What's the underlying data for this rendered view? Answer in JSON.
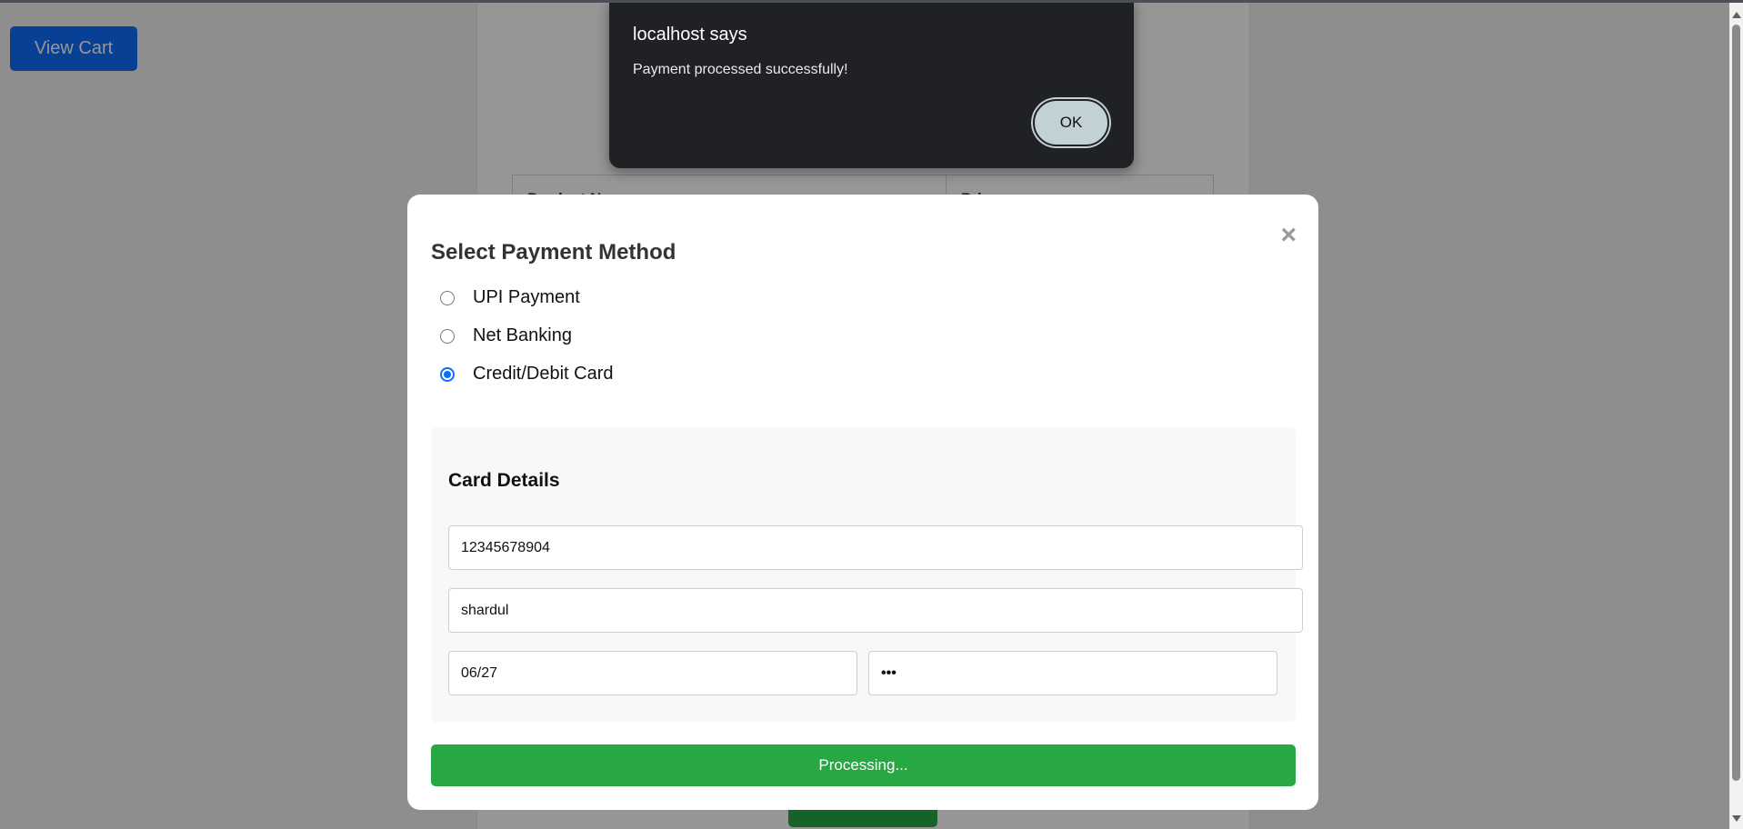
{
  "page": {
    "view_cart_label": "View Cart",
    "table_headers": [
      "Product Name",
      "Price"
    ]
  },
  "modal": {
    "title": "Select Payment Method",
    "close_glyph": "×",
    "payment_methods": [
      {
        "label": "UPI Payment",
        "checked": false
      },
      {
        "label": "Net Banking",
        "checked": false
      },
      {
        "label": "Credit/Debit Card",
        "checked": true
      }
    ],
    "card_details": {
      "title": "Card Details",
      "card_number": "12345678904",
      "card_name": "shardul",
      "expiry": "06/27",
      "cvv": "•••"
    },
    "submit_label": "Processing..."
  },
  "alert": {
    "title": "localhost says",
    "message": "Payment processed successfully!",
    "ok_label": "OK"
  },
  "colors": {
    "primary": "#0d6efd",
    "success": "#28a745",
    "alert_bg": "#202124"
  }
}
